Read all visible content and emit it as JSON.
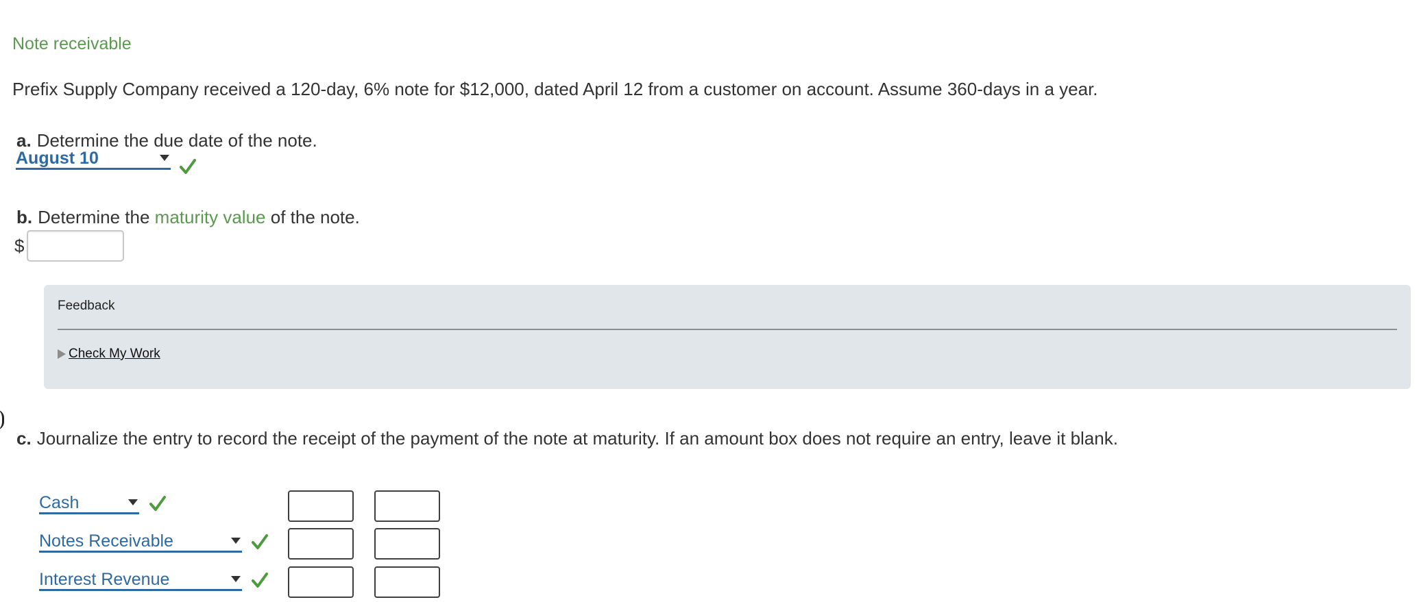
{
  "title": "Note receivable",
  "problem_text": "Prefix Supply Company received a 120-day, 6% note for $12,000, dated April 12 from a customer on account. Assume 360-days in a year.",
  "part_a": {
    "label": "a.",
    "text": "Determine the due date of the note.",
    "dropdown_value": "August 10",
    "status_icon": "check-icon"
  },
  "part_b": {
    "label": "b.",
    "text_before": "Determine the",
    "term": "maturity value",
    "text_after": "of the note.",
    "currency_symbol": "$",
    "amount_value": ""
  },
  "feedback": {
    "title": "Feedback",
    "check_my_work": "Check My Work"
  },
  "part_c": {
    "label": "c.",
    "text": "Journalize the entry to record the receipt of the payment of the note at maturity. If an amount box does not require an entry, leave it blank.",
    "rows": [
      {
        "account": "Cash",
        "debit": "",
        "credit": ""
      },
      {
        "account": "Notes Receivable",
        "debit": "",
        "credit": ""
      },
      {
        "account": "Interest Revenue",
        "debit": "",
        "credit": ""
      }
    ]
  },
  "colors": {
    "accent_green": "#5a9a4e",
    "link_blue": "#2d6aa3",
    "feedback_bg": "#e0e6e9"
  }
}
